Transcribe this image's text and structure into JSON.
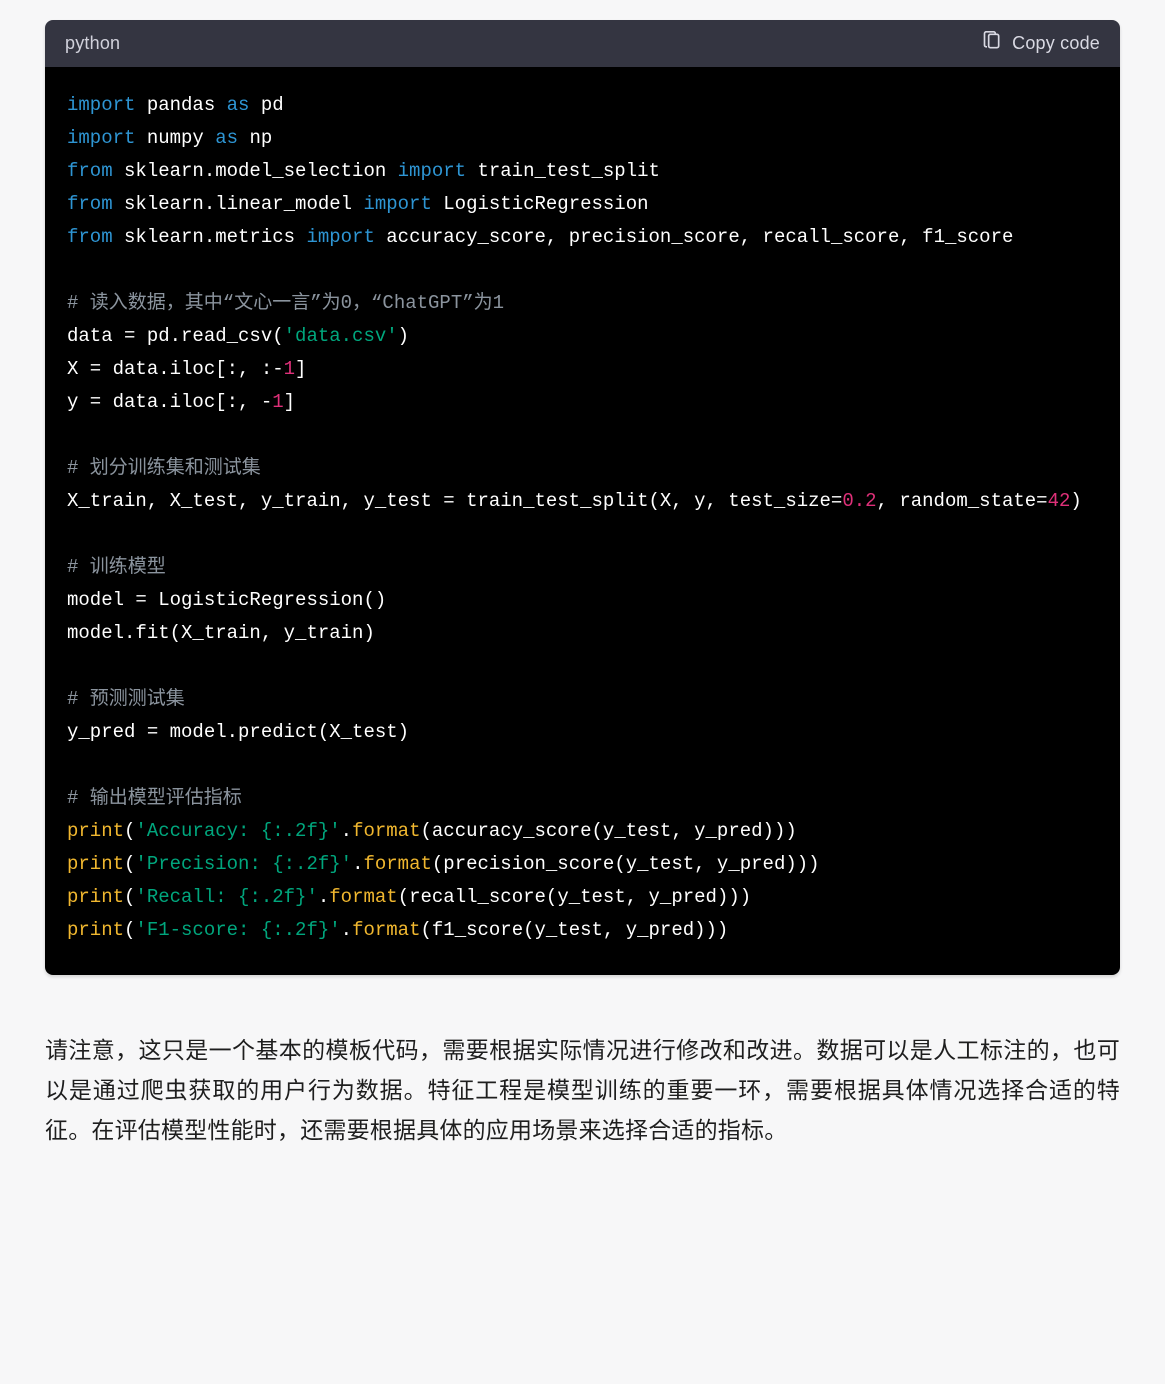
{
  "code_block": {
    "language_label": "python",
    "copy_label": "Copy code",
    "lines": {
      "l1_kw1": "import",
      "l1_mod": " pandas ",
      "l1_kw2": "as",
      "l1_alias": " pd",
      "l2_kw1": "import",
      "l2_mod": " numpy ",
      "l2_kw2": "as",
      "l2_alias": " np",
      "l3_kw1": "from",
      "l3_mod": " sklearn.model_selection ",
      "l3_kw2": "import",
      "l3_sym": " train_test_split",
      "l4_kw1": "from",
      "l4_mod": " sklearn.linear_model ",
      "l4_kw2": "import",
      "l4_sym": " LogisticRegression",
      "l5_kw1": "from",
      "l5_mod": " sklearn.metrics ",
      "l5_kw2": "import",
      "l5_sym": " accuracy_score, precision_score, recall_score, f1_score",
      "l7_cmt": "# 读入数据，其中“文心一言”为0，“ChatGPT”为1",
      "l8_a": "data = pd.read_csv(",
      "l8_str": "'data.csv'",
      "l8_b": ")",
      "l9_a": "X = data.iloc[:, :-",
      "l9_num": "1",
      "l9_b": "]",
      "l10_a": "y = data.iloc[:, -",
      "l10_num": "1",
      "l10_b": "]",
      "l12_cmt": "# 划分训练集和测试集",
      "l13_a": "X_train, X_test, y_train, y_test = train_test_split(X, y, test_size=",
      "l13_num1": "0.2",
      "l13_b": ", random_state=",
      "l13_num2": "42",
      "l13_c": ")",
      "l15_cmt": "# 训练模型",
      "l16": "model = LogisticRegression()",
      "l17": "model.fit(X_train, y_train)",
      "l19_cmt": "# 预测测试集",
      "l20": "y_pred = model.predict(X_test)",
      "l22_cmt": "# 输出模型评估指标",
      "l23_fn": "print",
      "l23_a": "(",
      "l23_str": "'Accuracy: {:.2f}'",
      "l23_b": ".",
      "l23_fmt": "format",
      "l23_c": "(accuracy_score(y_test, y_pred)))",
      "l24_fn": "print",
      "l24_a": "(",
      "l24_str": "'Precision: {:.2f}'",
      "l24_b": ".",
      "l24_fmt": "format",
      "l24_c": "(precision_score(y_test, y_pred)))",
      "l25_fn": "print",
      "l25_a": "(",
      "l25_str": "'Recall: {:.2f}'",
      "l25_b": ".",
      "l25_fmt": "format",
      "l25_c": "(recall_score(y_test, y_pred)))",
      "l26_fn": "print",
      "l26_a": "(",
      "l26_str": "'F1-score: {:.2f}'",
      "l26_b": ".",
      "l26_fmt": "format",
      "l26_c": "(f1_score(y_test, y_pred)))"
    }
  },
  "explanation": "请注意，这只是一个基本的模板代码，需要根据实际情况进行修改和改进。数据可以是人工标注的，也可以是通过爬虫获取的用户行为数据。特征工程是模型训练的重要一环，需要根据具体情况选择合适的特征。在评估模型性能时，还需要根据具体的应用场景来选择合适的指标。"
}
